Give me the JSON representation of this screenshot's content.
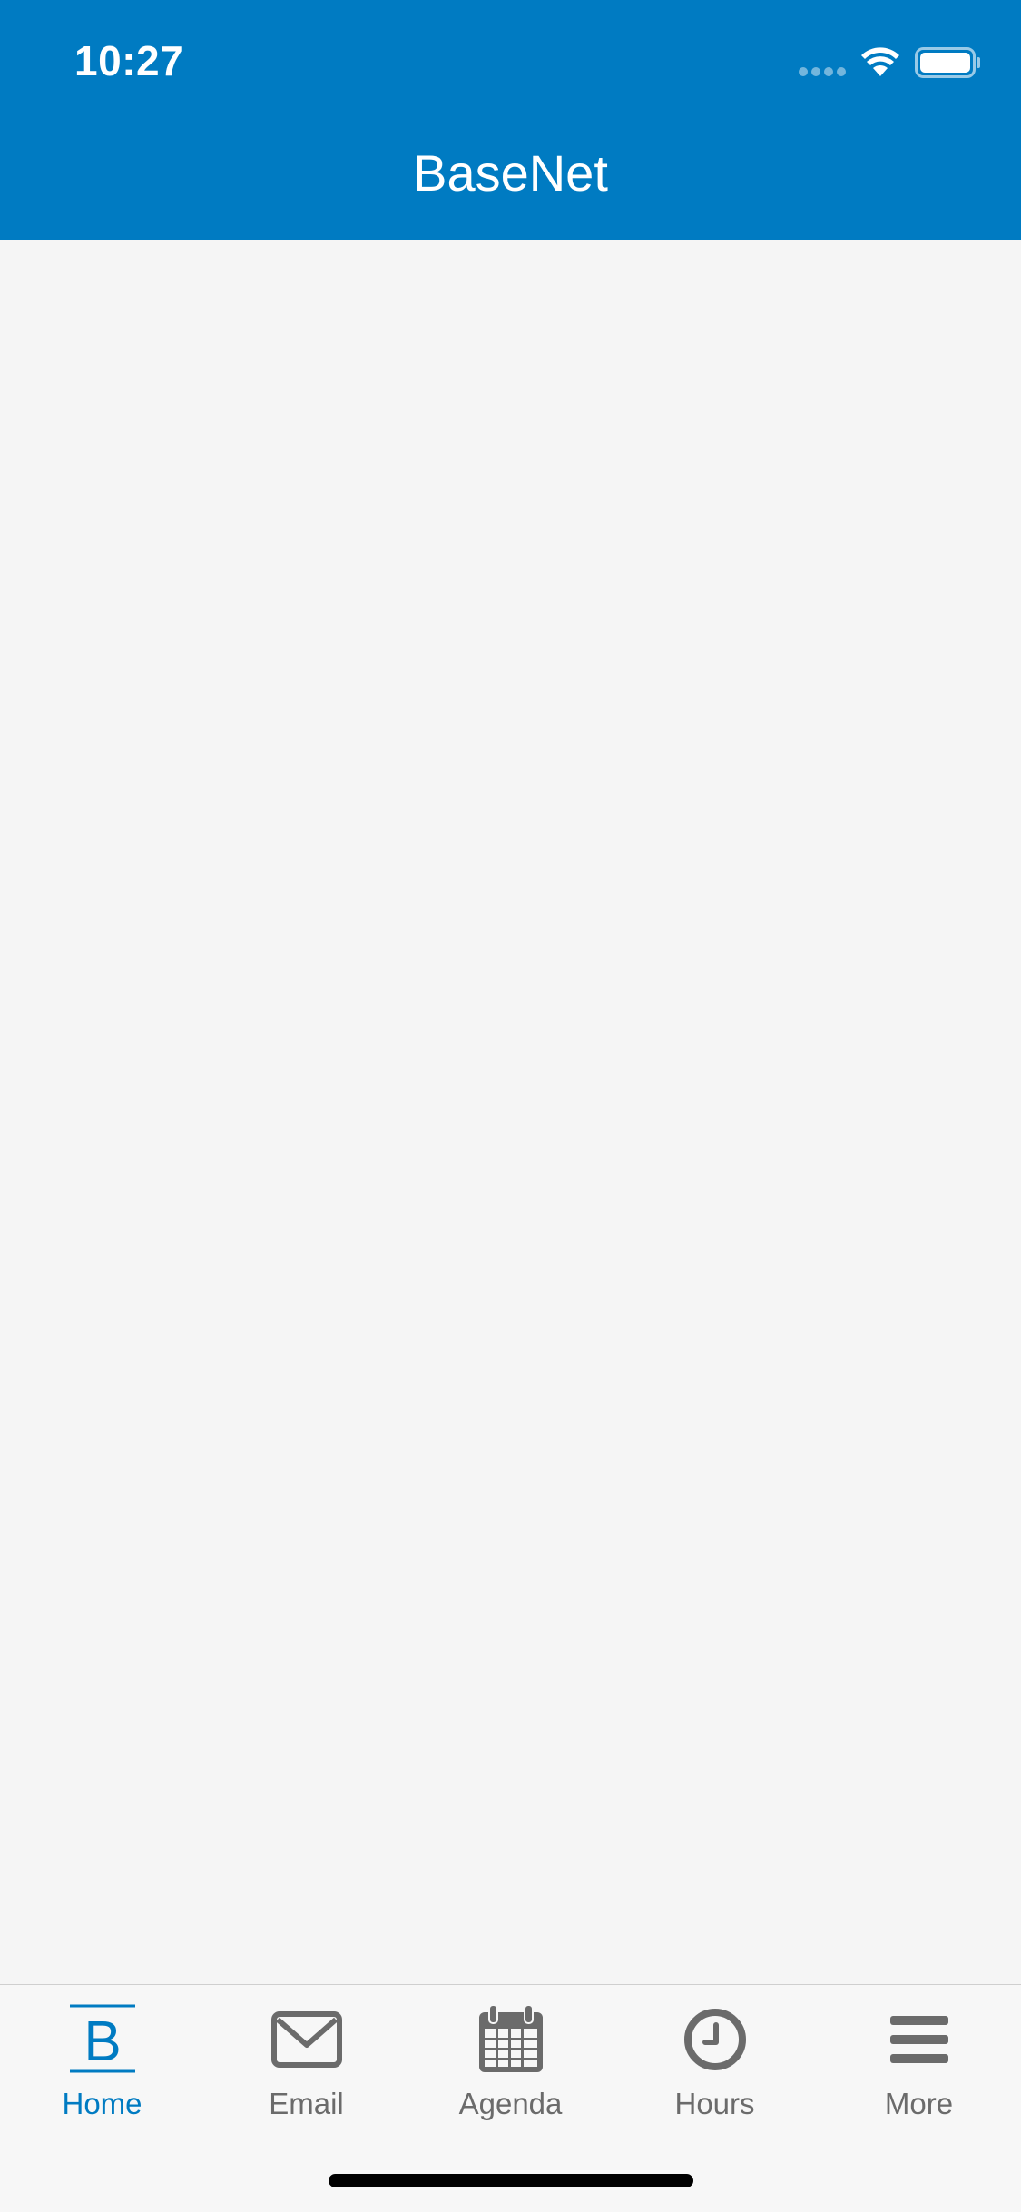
{
  "status_bar": {
    "time": "10:27"
  },
  "header": {
    "title": "BaseNet",
    "background": "#007bc2"
  },
  "tabbar": {
    "tabs": [
      {
        "label": "Home",
        "icon": "basenet-b-icon",
        "active": true
      },
      {
        "label": "Email",
        "icon": "envelope-icon",
        "active": false
      },
      {
        "label": "Agenda",
        "icon": "calendar-icon",
        "active": false
      },
      {
        "label": "Hours",
        "icon": "clock-icon",
        "active": false
      },
      {
        "label": "More",
        "icon": "menu-icon",
        "active": false
      }
    ],
    "active_color": "#007bc2",
    "inactive_color": "#6b6b6b"
  }
}
